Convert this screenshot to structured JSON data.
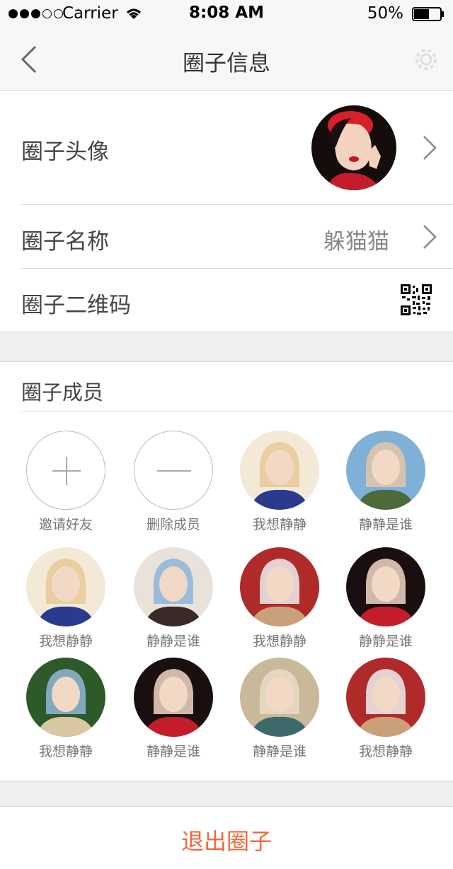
{
  "status_bar": {
    "carrier": "Carrier",
    "time": "8:08 AM",
    "battery": "50%",
    "signal_bars_filled": 3,
    "signal_bars_total": 5,
    "battery_level": 0.5
  },
  "nav": {
    "title": "圈子信息",
    "back_icon": "chevron-left-icon",
    "settings_icon": "gear-icon"
  },
  "info": {
    "avatar_label": "圈子头像",
    "name_label": "圈子名称",
    "name_value": "躲猫猫",
    "qrcode_label": "圈子二维码"
  },
  "members": {
    "title": "圈子成员",
    "invite_label": "邀请好友",
    "remove_label": "删除成员",
    "list": [
      {
        "name": "我想静静",
        "palette": [
          "#f4e8d6",
          "#2a3a8f",
          "#e8c995"
        ]
      },
      {
        "name": "静静是谁",
        "palette": [
          "#7fb0d8",
          "#4c6a3a",
          "#e2c7a8"
        ]
      },
      {
        "name": "我想静静",
        "palette": [
          "#f4e8d6",
          "#2a3a8f",
          "#e8c995"
        ]
      },
      {
        "name": "静静是谁",
        "palette": [
          "#e9e2db",
          "#3a2a25",
          "#8cb5dc"
        ]
      },
      {
        "name": "我想静静",
        "palette": [
          "#b02a2a",
          "#c9a07a",
          "#eeeeee"
        ]
      },
      {
        "name": "静静是谁",
        "palette": [
          "#1a0f0f",
          "#c31c2a",
          "#f2d7c4"
        ]
      },
      {
        "name": "我想静静",
        "palette": [
          "#2e5a2a",
          "#d8c7a0",
          "#8fb6d6"
        ]
      },
      {
        "name": "静静是谁",
        "palette": [
          "#1a0f0f",
          "#c31c2a",
          "#f2d7c4"
        ]
      },
      {
        "name": "静静是谁",
        "palette": [
          "#c9b89a",
          "#3c6a6a",
          "#e8dcc7"
        ]
      },
      {
        "name": "我想静静",
        "palette": [
          "#b02a2a",
          "#c9a07a",
          "#eeeeee"
        ]
      }
    ]
  },
  "footer": {
    "exit_label": "退出圈子"
  },
  "colors": {
    "accent": "#ef6a3d",
    "background_gray": "#efefef",
    "divider": "#dcdcdc"
  }
}
